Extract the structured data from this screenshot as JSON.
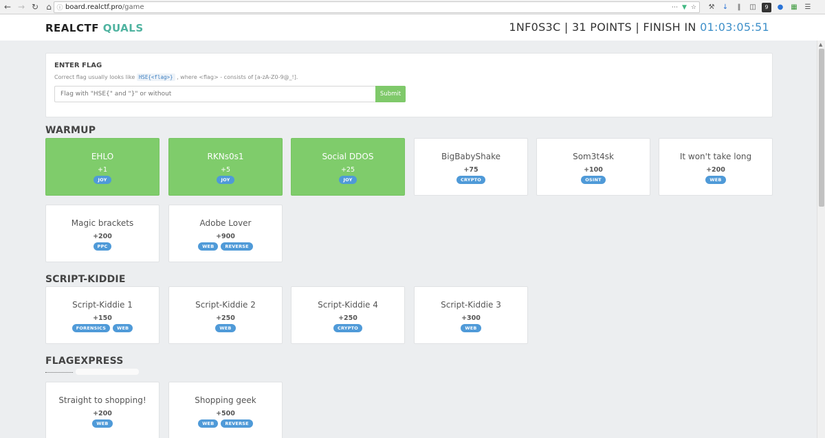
{
  "browser": {
    "url_host": "board.realctf.pro",
    "url_path": "/game",
    "extension_badge": "9"
  },
  "header": {
    "brand_main": "REALCTF",
    "brand_accent": "QUALS",
    "status_prefix": "1NF0S3C | 31 POINTS | FINISH IN",
    "timer": "01:03:05:51"
  },
  "flag_panel": {
    "title": "ENTER FLAG",
    "hint_before": "Correct flag usually looks like",
    "hint_code": "HSE{<flag>}",
    "hint_after": ", where <flag> - consists of [a-zA-Z0-9@_!].",
    "input_placeholder": "Flag with \"HSE{\" and \"}\" or without",
    "submit_label": "Submit"
  },
  "sections": [
    {
      "title": "WARMUP",
      "tasks": [
        {
          "name": "EHLO",
          "points": "+1",
          "tags": [
            "JOY"
          ],
          "solved": true
        },
        {
          "name": "RKNs0s1",
          "points": "+5",
          "tags": [
            "JOY"
          ],
          "solved": true
        },
        {
          "name": "Social DDOS",
          "points": "+25",
          "tags": [
            "JOY"
          ],
          "solved": true
        },
        {
          "name": "BigBabyShake",
          "points": "+75",
          "tags": [
            "CRYPTO"
          ],
          "solved": false
        },
        {
          "name": "Som3t4sk",
          "points": "+100",
          "tags": [
            "OSINT"
          ],
          "solved": false
        },
        {
          "name": "It won't take long",
          "points": "+200",
          "tags": [
            "WEB"
          ],
          "solved": false
        },
        {
          "name": "Magic brackets",
          "points": "+200",
          "tags": [
            "PPC"
          ],
          "solved": false
        },
        {
          "name": "Adobe Lover",
          "points": "+900",
          "tags": [
            "WEB",
            "REVERSE"
          ],
          "solved": false
        }
      ]
    },
    {
      "title": "SCRIPT-KIDDIE",
      "tasks": [
        {
          "name": "Script-Kiddie 1",
          "points": "+150",
          "tags": [
            "FORENSICS",
            "WEB"
          ],
          "solved": false
        },
        {
          "name": "Script-Kiddie 2",
          "points": "+250",
          "tags": [
            "WEB"
          ],
          "solved": false
        },
        {
          "name": "Script-Kiddie 4",
          "points": "+250",
          "tags": [
            "CRYPTO"
          ],
          "solved": false
        },
        {
          "name": "Script-Kiddie 3",
          "points": "+300",
          "tags": [
            "WEB"
          ],
          "solved": false
        }
      ]
    },
    {
      "title": "FLAGEXPRESS",
      "tasks": [
        {
          "name": "Straight to shopping!",
          "points": "+200",
          "tags": [
            "WEB"
          ],
          "solved": false
        },
        {
          "name": "Shopping geek",
          "points": "+500",
          "tags": [
            "WEB",
            "REVERSE"
          ],
          "solved": false
        }
      ]
    }
  ]
}
